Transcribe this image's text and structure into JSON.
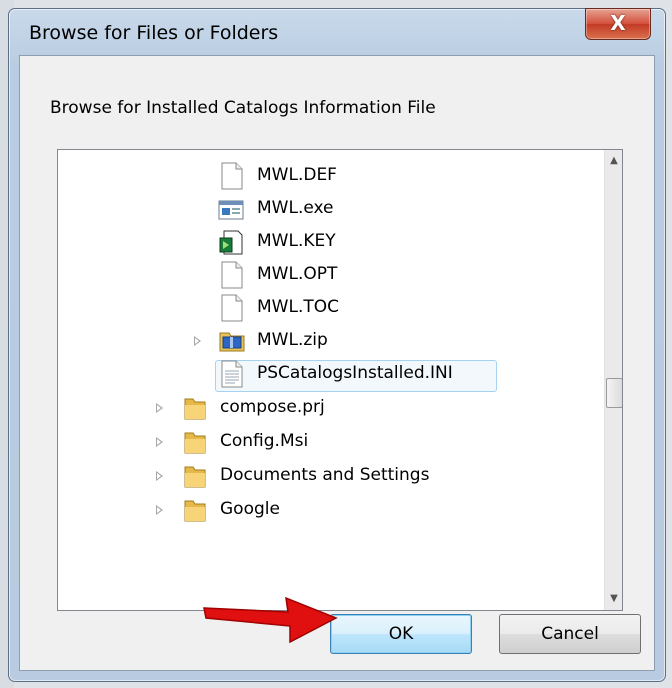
{
  "window": {
    "title": "Browse for Files or Folders",
    "close_label": "X"
  },
  "dialog": {
    "instruction": "Browse for Installed Catalogs Information File"
  },
  "tree": {
    "items": [
      {
        "label": "MWL.DEF",
        "icon": "file-icon"
      },
      {
        "label": "MWL.exe",
        "icon": "executable-icon"
      },
      {
        "label": "MWL.KEY",
        "icon": "key-file-icon"
      },
      {
        "label": "MWL.OPT",
        "icon": "file-icon"
      },
      {
        "label": "MWL.TOC",
        "icon": "file-icon"
      },
      {
        "label": "MWL.zip",
        "icon": "zip-folder-icon"
      },
      {
        "label": "PSCatalogsInstalled.INI",
        "icon": "ini-file-icon",
        "selected": true
      },
      {
        "label": "compose.prj",
        "icon": "folder-icon"
      },
      {
        "label": "Config.Msi",
        "icon": "folder-icon"
      },
      {
        "label": "Documents and Settings",
        "icon": "folder-icon"
      },
      {
        "label": "Google",
        "icon": "folder-icon"
      }
    ]
  },
  "buttons": {
    "ok_label": "OK",
    "cancel_label": "Cancel"
  },
  "colors": {
    "selection_fill": "#f3f8fd",
    "selection_border": "#a5d2f2",
    "annotation_arrow": "#e01010"
  }
}
